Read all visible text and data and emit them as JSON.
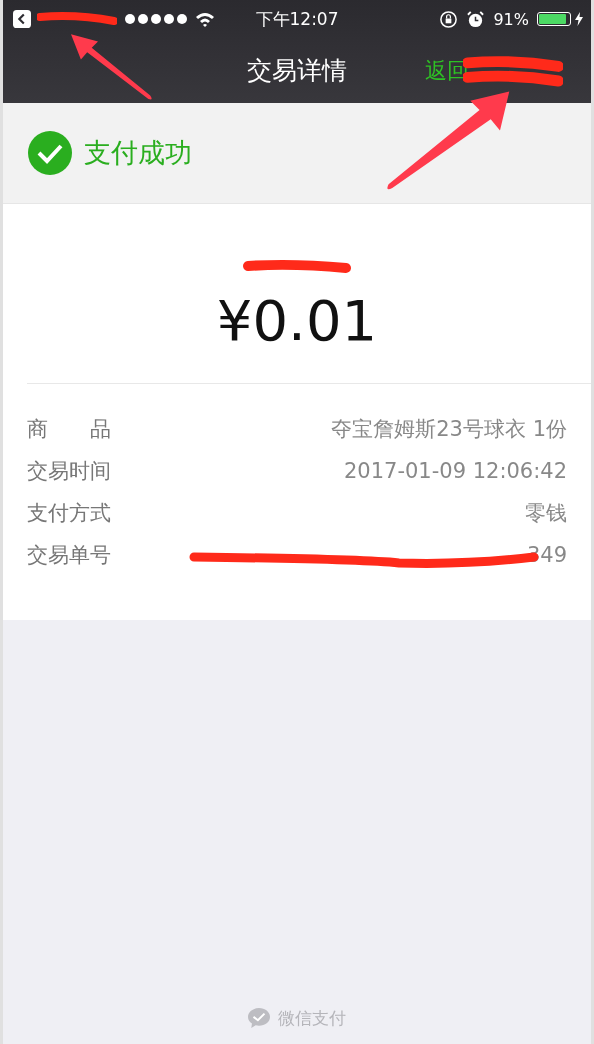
{
  "status_bar": {
    "back_redacted": true,
    "time": "下午12:07",
    "battery": "91%"
  },
  "nav": {
    "title": "交易详情",
    "back_link": "返回",
    "back_redacted": true
  },
  "result": {
    "text": "支付成功"
  },
  "payment": {
    "merchant_redacted": true,
    "amount": "¥0.01"
  },
  "details": [
    {
      "label": "商　　品",
      "value": "夺宝詹姆斯23号球衣 1份",
      "redacted": false
    },
    {
      "label": "交易时间",
      "value": "2017-01-09 12:06:42",
      "redacted": false
    },
    {
      "label": "支付方式",
      "value": "零钱",
      "redacted": false
    },
    {
      "label": "交易单号",
      "value": "349",
      "redacted": true
    }
  ],
  "footer": {
    "brand": "微信支付"
  }
}
